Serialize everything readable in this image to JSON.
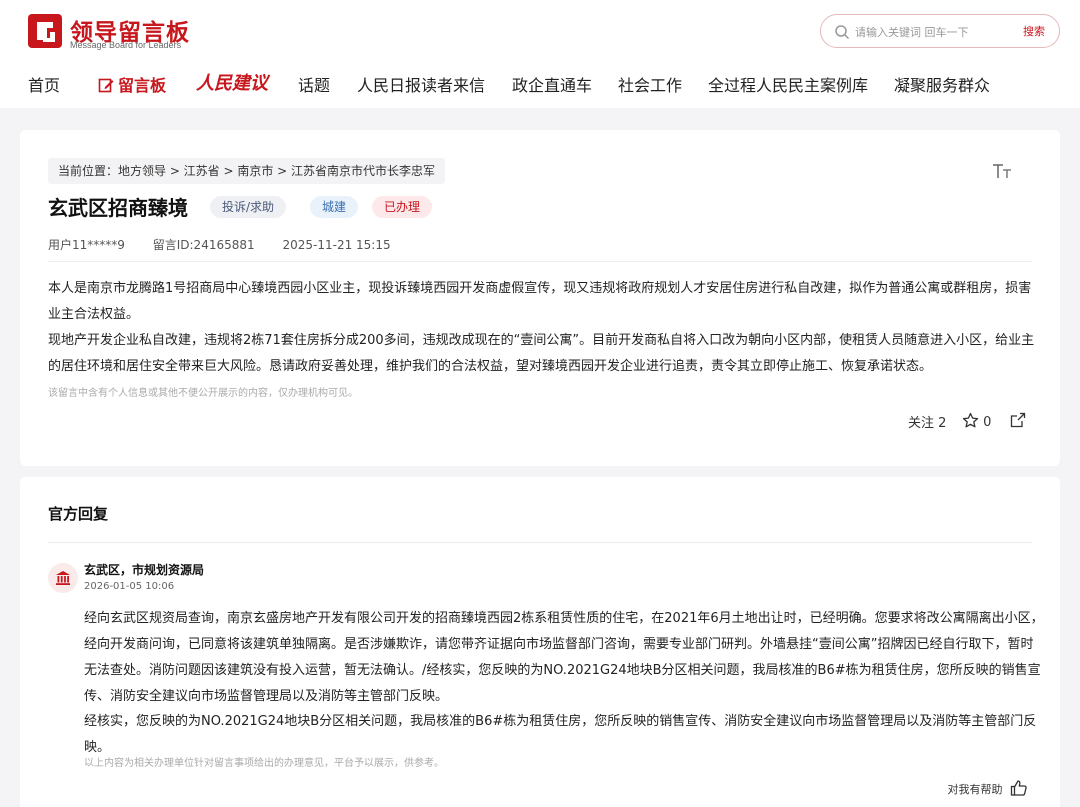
{
  "header": {
    "logo_title": "领导留言板",
    "logo_sub": "Message Board for Leaders",
    "search_placeholder": "请输入关键词 回车一下",
    "search_button": "搜索"
  },
  "nav": [
    {
      "label": "首页"
    },
    {
      "label": "留言板"
    },
    {
      "label": "人民建议"
    },
    {
      "label": "话题"
    },
    {
      "label": "人民日报读者来信"
    },
    {
      "label": "政企直通车"
    },
    {
      "label": "社会工作"
    },
    {
      "label": "全过程人民民主案例库"
    },
    {
      "label": "凝聚服务群众"
    }
  ],
  "message": {
    "breadcrumb": "当前位置：地方领导 > 江苏省 > 南京市 > 江苏省南京市代市长李忠军",
    "title": "玄武区招商臻境",
    "tags": {
      "type": "投诉/求助",
      "domain": "城建",
      "status": "已办理"
    },
    "user": "用户11*****9",
    "msg_id": "留言ID:24165881",
    "time": "2025-11-21 15:15",
    "paragraph1": "本人是南京市龙腾路1号招商局中心臻境西园小区业主，现投诉臻境西园开发商虚假宣传，现又违规将政府规划人才安居住房进行私自改建，拟作为普通公寓或群租房，损害业主合法权益。",
    "paragraph2": "现地产开发企业私自改建，违规将2栋71套住房拆分成200多间，违规改成现在的“壹间公寓”。目前开发商私自将入口改为朝向小区内部，使租赁人员随意进入小区，给业主的居住环境和居住安全带来巨大风险。恳请政府妥善处理，维护我们的合法权益，望对臻境西园开发企业进行追责，责令其立即停止施工、恢复承诺状态。",
    "notice": "该留言中含有个人信息或其他不便公开展示的内容，仅办理机构可见。",
    "follow_label": "关注 2",
    "like_count": "0"
  },
  "reply": {
    "heading": "官方回复",
    "org": "玄武区，市规划资源局",
    "time": "2026-01-05 10:06",
    "paragraph1": "经向玄武区规资局查询，南京玄盛房地产开发有限公司开发的招商臻境西园2栋系租赁性质的住宅，在2021年6月土地出让时，已经明确。您要求将改公寓隔离出小区，经向开发商问询，已同意将该建筑单独隔离。是否涉嫌欺诈，请您带齐证据向市场监督部门咨询，需要专业部门研判。外墙悬挂“壹间公寓”招牌因已经自行取下，暂时无法查处。消防问题因该建筑没有投入运营，暂无法确认。/经核实，您反映的为NO.2021G24地块B分区相关问题，我局核准的B6#栋为租赁住房，您所反映的销售宣传、消防安全建议向市场监督管理局以及消防等主管部门反映。",
    "paragraph2": "经核实，您反映的为NO.2021G24地块B分区相关问题，我局核准的B6#栋为租赁住房，您所反映的销售宣传、消防安全建议向市场监督管理局以及消防等主管部门反映。",
    "note": "以上内容为相关办理单位针对留言事项给出的办理意见，平台予以展示，供参考。",
    "helpful_label": "对我有帮助"
  },
  "colors": {
    "brand": "#c8161d",
    "background": "#f4f4f6"
  },
  "icons": [
    "logo-icon",
    "search-icon",
    "edit-icon",
    "font-size-icon",
    "star-icon",
    "share-icon",
    "government-building-icon",
    "thumbs-up-icon"
  ]
}
